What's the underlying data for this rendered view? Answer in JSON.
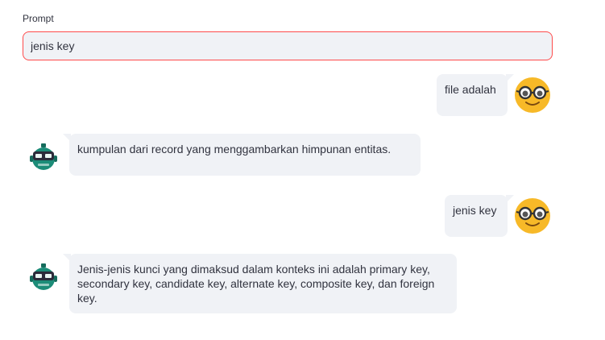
{
  "prompt": {
    "label": "Prompt",
    "value": "jenis key"
  },
  "messages": [
    {
      "role": "user",
      "text": "file adalah",
      "avatar": "nerd-face-icon"
    },
    {
      "role": "bot",
      "text": "kumpulan dari record yang menggambarkan himpunan entitas.",
      "avatar": "robot-icon"
    },
    {
      "role": "user",
      "text": "jenis key",
      "avatar": "nerd-face-icon"
    },
    {
      "role": "bot",
      "text": "Jenis-jenis kunci yang dimaksud dalam konteks ini adalah primary key, secondary key, candidate key, alternate key, composite key, dan foreign key.",
      "avatar": "robot-icon"
    }
  ],
  "colors": {
    "accent": "#ff4b4b",
    "bubble": "#f0f2f6",
    "user_avatar": "#f7b928",
    "bot_avatar": "#1c8c78"
  }
}
